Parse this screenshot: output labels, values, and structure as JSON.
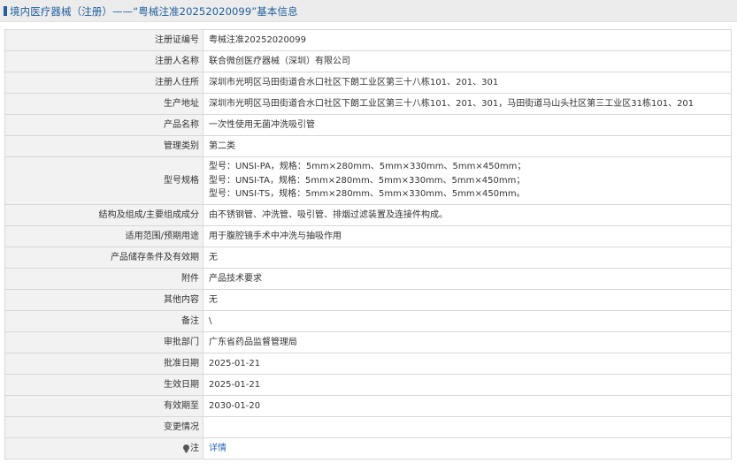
{
  "page": {
    "title": "境内医疗器械（注册）——“粤械注准20252020099”基本信息"
  },
  "rows": [
    {
      "label": "注册证编号",
      "value": "粤械注准20252020099"
    },
    {
      "label": "注册人名称",
      "value": "联合微创医疗器械（深圳）有限公司"
    },
    {
      "label": "注册人住所",
      "value": "深圳市光明区马田街道合水口社区下朗工业区第三十八栋101、201、301"
    },
    {
      "label": "生产地址",
      "value": "深圳市光明区马田街道合水口社区下朗工业区第三十八栋101、201、301，马田街道马山头社区第三工业区31栋101、201"
    },
    {
      "label": "产品名称",
      "value": "一次性使用无菌冲洗吸引管"
    },
    {
      "label": "管理类别",
      "value": "第二类"
    },
    {
      "label": "型号规格",
      "lines": [
        "型号：UNSI-PA，规格：5mm×280mm、5mm×330mm、5mm×450mm；",
        "型号：UNSI-TA，规格：5mm×280mm、5mm×330mm、5mm×450mm；",
        "型号：UNSI-TS，规格：5mm×280mm、5mm×330mm、5mm×450mm。"
      ]
    },
    {
      "label": "结构及组成/主要组成成分",
      "value": "由不锈钢管、冲洗管、吸引管、排烟过滤装置及连接件构成。"
    },
    {
      "label": "适用范围/预期用途",
      "value": "用于腹腔镜手术中冲洗与抽吸作用"
    },
    {
      "label": "产品储存条件及有效期",
      "value": "无"
    },
    {
      "label": "附件",
      "value": "产品技术要求"
    },
    {
      "label": "其他内容",
      "value": "无"
    },
    {
      "label": "备注",
      "value": "\\"
    },
    {
      "label": "审批部门",
      "value": "广东省药品监督管理局"
    },
    {
      "label": "批准日期",
      "value": "2025-01-21"
    },
    {
      "label": "生效日期",
      "value": "2025-01-21"
    },
    {
      "label": "有效期至",
      "value": "2030-01-20"
    },
    {
      "label": "变更情况",
      "value": ""
    },
    {
      "label": "注",
      "value": "详情",
      "icon": "note-icon"
    }
  ]
}
